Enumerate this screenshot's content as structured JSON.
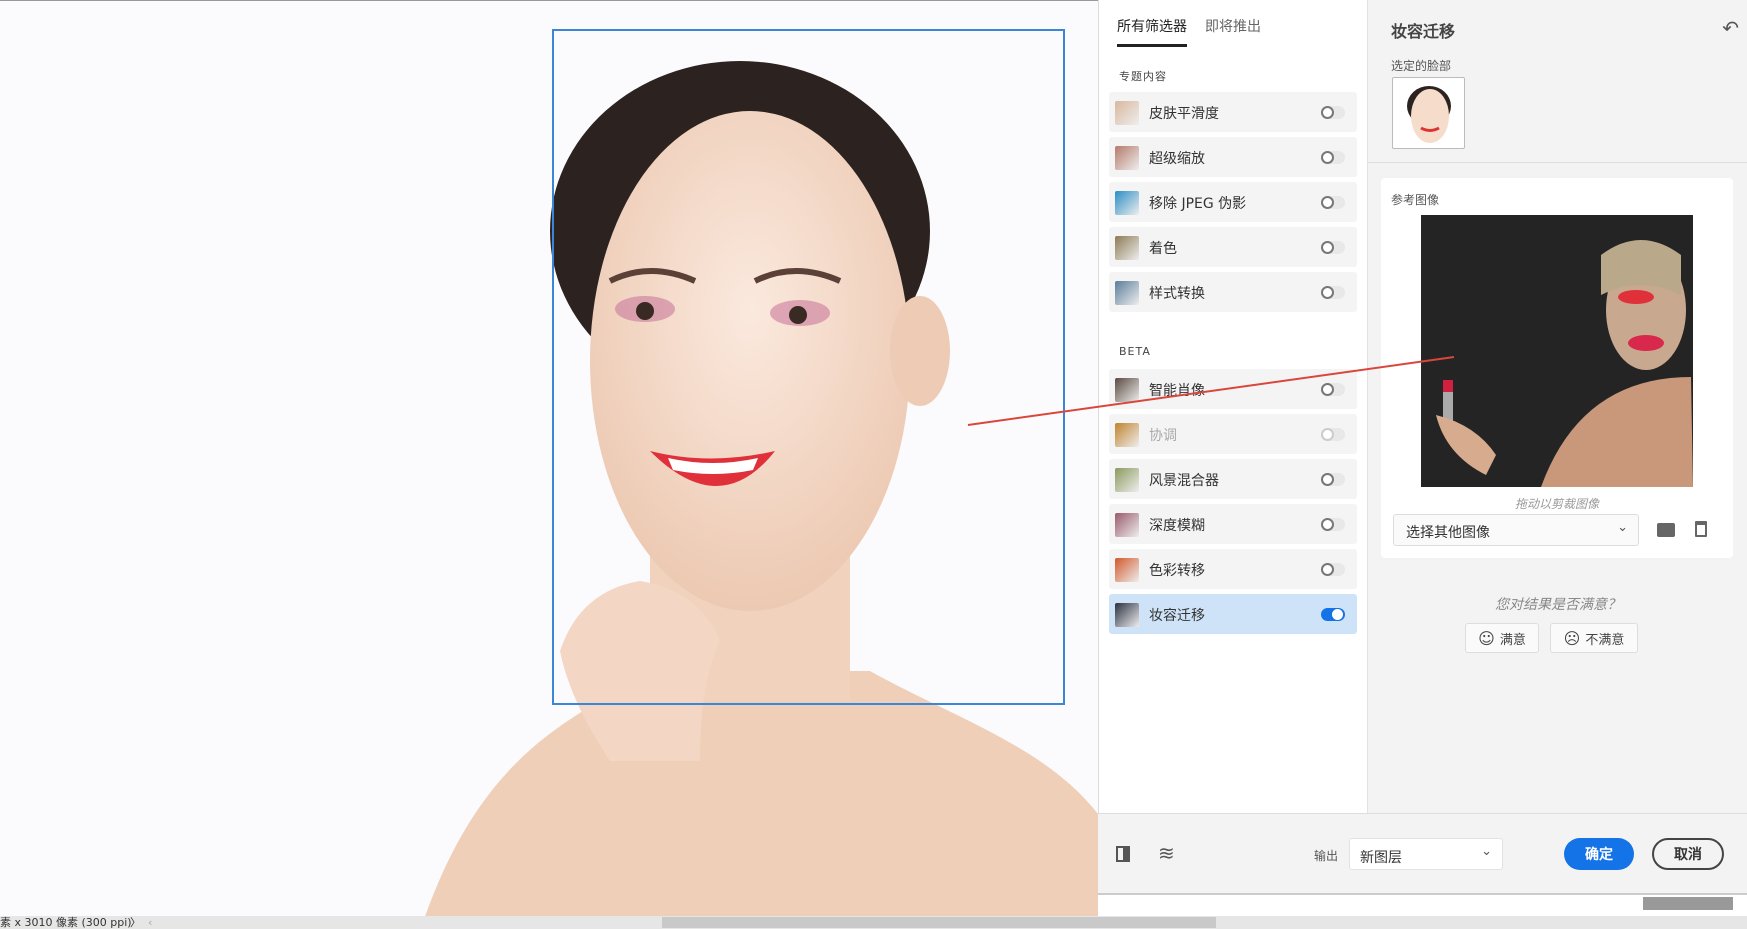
{
  "canvas": {
    "status_text": "素 x 3010 像素 (300 ppi)",
    "status_arrow": "〉",
    "scroll_left": "‹"
  },
  "tabs": [
    {
      "label": "所有筛选器"
    },
    {
      "label": "即将推出"
    }
  ],
  "sections": {
    "featured": "专题内容",
    "beta": "BETA"
  },
  "filters": [
    {
      "label": "皮肤平滑度",
      "on": false,
      "color": "#d9b79d"
    },
    {
      "label": "超级缩放",
      "on": false,
      "color": "#b57a6a"
    },
    {
      "label": "移除 JPEG 伪影",
      "on": false,
      "color": "#2a8fc4"
    },
    {
      "label": "着色",
      "on": false,
      "color": "#8c7a55"
    },
    {
      "label": "样式转换",
      "on": false,
      "color": "#5a7d9a"
    }
  ],
  "beta_filters": [
    {
      "label": "智能肖像",
      "on": false,
      "color": "#5a4a40"
    },
    {
      "label": "协调",
      "on": false,
      "disabled": true,
      "color": "#c0832d"
    },
    {
      "label": "风景混合器",
      "on": false,
      "color": "#8a9a5c"
    },
    {
      "label": "深度模糊",
      "on": false,
      "color": "#9a5a6a"
    },
    {
      "label": "色彩转移",
      "on": false,
      "color": "#d2582a"
    },
    {
      "label": "妆容迁移",
      "on": true,
      "color": "#2a3040"
    }
  ],
  "detail": {
    "title": "妆容迁移",
    "reset_icon": "undo-icon",
    "selected_face_label": "选定的脸部",
    "reference_label": "参考图像",
    "crop_hint": "拖动以剪裁图像",
    "select_value": "选择其他图像",
    "feedback_question": "您对结果是否满意？",
    "satisfied": "满意",
    "unsatisfied": "不满意"
  },
  "bottom": {
    "output_label": "输出",
    "output_value": "新图层",
    "ok": "确定",
    "cancel": "取消",
    "accent": "#1473e6"
  }
}
